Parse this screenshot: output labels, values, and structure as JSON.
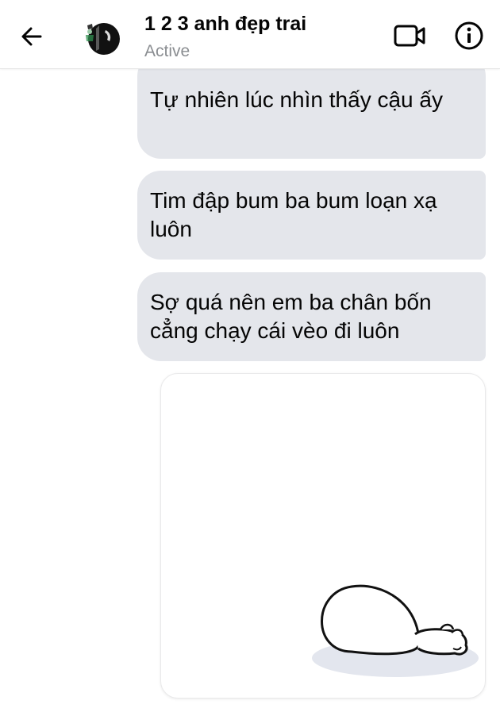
{
  "header": {
    "contact_name": "1 2 3 anh đẹp trai",
    "status": "Active",
    "icons": {
      "back": "back-arrow-icon",
      "video": "video-call-icon",
      "info": "info-icon"
    }
  },
  "messages": [
    {
      "text": "Tự nhiên lúc nhìn thấy cậu ấy"
    },
    {
      "text": "Tim đập bum ba bum loạn xạ luôn"
    },
    {
      "text": "Sợ quá nên em ba chân bốn cẳng chạy cái vèo đi luôn"
    }
  ],
  "colors": {
    "bubble_bg": "#e4e6eb",
    "text": "#050505",
    "status_text": "#8a8d91"
  }
}
